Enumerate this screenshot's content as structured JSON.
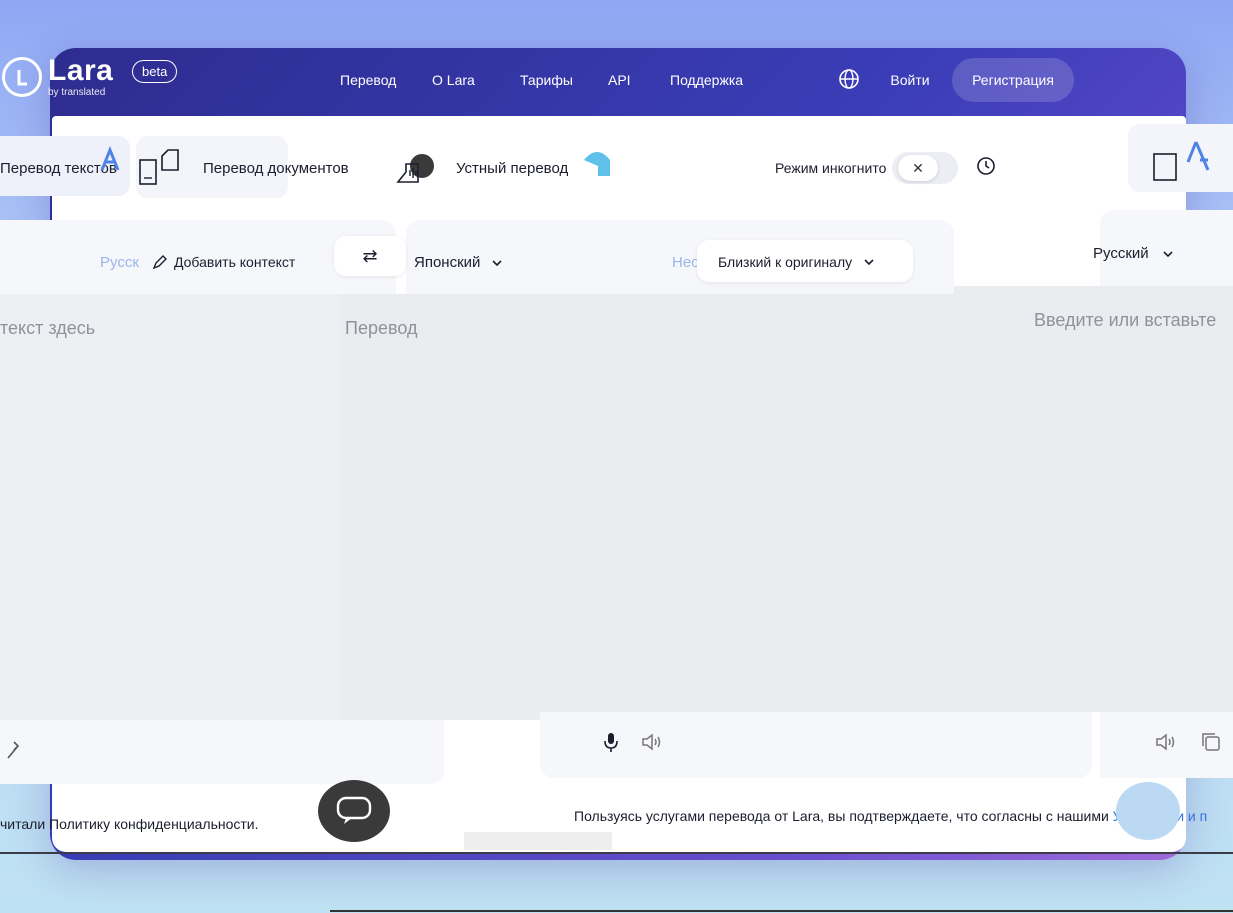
{
  "header": {
    "logo_name": "Lara",
    "logo_sub": "by translated",
    "beta": "beta",
    "nav": [
      {
        "label": "Перевод"
      },
      {
        "label": "О Lara"
      },
      {
        "label": "Тарифы"
      },
      {
        "label": "API"
      },
      {
        "label": "Поддержка"
      }
    ],
    "login": "Войти",
    "register": "Регистрация"
  },
  "tabs": {
    "text": "Перевод текстов",
    "documents": "Перевод документов",
    "voice": "Устный перевод",
    "incognito": "Режим инкогнито"
  },
  "translator": {
    "source_lang_faded": "Русск",
    "add_context": "Добавить контекст",
    "target_lang": "Японский",
    "target_lang_faded": "Неопр",
    "style": "Близкий к оригиналу",
    "right_lang": "Русский",
    "source_placeholder": "текст здесь",
    "target_placeholder": "Перевод",
    "right_placeholder": "Введите или вставьте"
  },
  "legal": {
    "left": "читали Политику конфиденциальности.",
    "right_prefix": "Пользуясь услугами перевода от Lara, вы подтверждаете, что согласны с нашими ",
    "right_link": "Условиями и п"
  },
  "colors": {
    "accent": "#4f83e8",
    "header_gradient_start": "#2d2c8f",
    "header_gradient_end": "#a06bdb"
  }
}
